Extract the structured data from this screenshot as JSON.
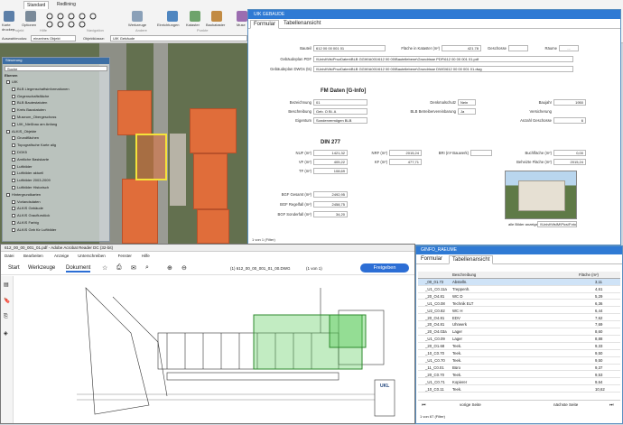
{
  "ribbon": {
    "tabs": [
      "Standard",
      "Redlining"
    ],
    "buttons": [
      "Karte drucken",
      "Optionen",
      "Werkzeuge",
      "Einrichtungen",
      "Kataster",
      "Baukataster",
      "Muse"
    ],
    "groups": [
      "Projekt",
      "Hilfe",
      "Navigation",
      "Andere",
      "Punkte"
    ],
    "fields": {
      "mode_label": "Auswahlmodus:",
      "mode_value": "einzelnes Objekt",
      "layer_label": "Objektklasse:",
      "layer_value": "UIK Gebäude"
    }
  },
  "layers": {
    "title": "Steuerung",
    "search": "Suche",
    "group_label": "Ebenen",
    "items": [
      "UIK",
      "BLB Liegenschaftsinformationen",
      "Gegenschaftsfläche",
      "BLB Bautestatuten",
      "Kreis Baustatuten",
      "Museum_Obergeschoss",
      "UIK_Nießbau am Anfang",
      "ALKIS_Objekte",
      "Grundflächen",
      "Topografische Karte alig",
      "DGK5",
      "Amtliche Basiskarte",
      "Luftbilder",
      "Luftbilder aktuell",
      "Luftbilder 2003-2009",
      "Luftbilder Historisch",
      "Hintergrundkarten",
      "Vorlandsdaten",
      "ALKIS Gebäude",
      "ALKIS Grauflurstück",
      "ALKIS Farbig",
      "ALKIS Geb für Luftbilder"
    ]
  },
  "form": {
    "window_title": "UIK GEBAUDE",
    "tabs": [
      "Formular",
      "Tabellenansicht"
    ],
    "fields": [
      {
        "label": "Bauteil",
        "value": "612 00 00 001 01"
      },
      {
        "label": "Fläche in Kataster (m²)",
        "value": "421.78"
      },
      {
        "label": "Geschosse",
        "value": ""
      },
      {
        "label": "Räume",
        "value": "..."
      },
      {
        "label": "Gebäudeplan PDF",
        "value": "\\\\UnivIt\\Ifs\\ProzDaten\\BLB GGW\\A001\\612 00 00\\Bautellebene\\Grundrisse PDF\\612 00 00 001 01.pdf"
      },
      {
        "label": "Gebäudeplan DWGs (ts)",
        "value": "\\\\UnivIt\\Ifs\\ProzDaten\\BLB GGW\\A001\\612 00 00\\Bautellebene\\Grundrisse DWG\\612 00 00 001 01.dwg"
      }
    ],
    "section_fm": "FM Daten [G-Info]",
    "fm": [
      {
        "label": "Bezeichnung",
        "value": "01"
      },
      {
        "label": "Beschreibung",
        "value": "Geb. O Bl. A"
      },
      {
        "label": "Eigentum",
        "value": "Sondervermögen BLB"
      },
      {
        "label": "Denkmalschutz",
        "value": "Nein"
      },
      {
        "label": "BLB Betreibervereinbarung",
        "value": "Ja"
      },
      {
        "label": "Versicherung",
        "value": ""
      },
      {
        "label": "Baujahr",
        "value": "1950"
      },
      {
        "label": "Anzahl Geschosse",
        "value": "6"
      }
    ],
    "section_din": "DIN 277",
    "din": [
      {
        "label": "NUF (m²)",
        "value": "1421,32"
      },
      {
        "label": "VF (m²)",
        "value": "405,22"
      },
      {
        "label": "TF (m²)",
        "value": "108,69"
      },
      {
        "label": "NRF (m²)",
        "value": "2015,24"
      },
      {
        "label": "KF (m²)",
        "value": "477,71"
      },
      {
        "label": "BRI (m³ Bauwerk)",
        "value": ""
      },
      {
        "label": "Buchfläche (m²)",
        "value": "0,00"
      },
      {
        "label": "Beheizte Fläche (m²)",
        "value": "2015,24"
      },
      {
        "label": "BGF Gesamt (m²)",
        "value": "2492,95"
      },
      {
        "label": "BGF Regelfall (m²)",
        "value": "2458,75"
      },
      {
        "label": "BGF Sonderfall (m²)",
        "value": "34,20"
      }
    ],
    "photo_caption": "alle Bilder anzeigen",
    "photo_file": "\\\\UnivIt\\IfsIM\\Pics\\Fotos",
    "status": "1 von 1 (Filter)"
  },
  "acrobat": {
    "window_title": "612_00_00_001_01.pdf - Adobe Acrobat Reader DC (32-bit)",
    "menu": [
      "Datei",
      "Bearbeiten",
      "Anzeige",
      "Unterschreiben",
      "Fenster",
      "Hilfe"
    ],
    "nav_tabs": [
      "Start",
      "Werkzeuge",
      "Dokument"
    ],
    "page_info": "(1) 612_00_00_001_01_00.DWG",
    "page_count": "(1 von 1)",
    "zoom": "12,3%",
    "share_button": "Freigeben",
    "logo_text": "UKL"
  },
  "ginfo": {
    "window_title": "GINFO_RAEUME",
    "tabs": [
      "Formular",
      "Tabellenansicht"
    ],
    "columns": [
      "Beschreibung",
      "Fläche (m²)"
    ],
    "rows": [
      {
        "id": "_00_01.72",
        "desc": "Abstelln.",
        "area": "3,11"
      },
      {
        "id": "_U1_C0.11a",
        "desc": "Treppenh.",
        "area": "4,61"
      },
      {
        "id": "_20_O4.81",
        "desc": "WC D",
        "area": "5,29"
      },
      {
        "id": "_U1_C0.08",
        "desc": "Technik ELT",
        "area": "6,36"
      },
      {
        "id": "_U2_C0.82",
        "desc": "WC H",
        "area": "6,44"
      },
      {
        "id": "_20_O4.81",
        "desc": "EDV",
        "area": "7,62"
      },
      {
        "id": "_20_O4.81",
        "desc": "Uhrwerk",
        "area": "7,69"
      },
      {
        "id": "_20_O4.03a",
        "desc": "Lager",
        "area": "8,60"
      },
      {
        "id": "_U1_C0.09",
        "desc": "Lager",
        "area": "8,88"
      },
      {
        "id": "_20_O1.68",
        "desc": "Teek.",
        "area": "9,33"
      },
      {
        "id": "_10_C0.70",
        "desc": "Teek.",
        "area": "9,50"
      },
      {
        "id": "_U1_C0.70",
        "desc": "Teek.",
        "area": "9,50"
      },
      {
        "id": "_11_C0.01",
        "desc": "Büro",
        "area": "9,37"
      },
      {
        "id": "_20_C0.70",
        "desc": "Teek.",
        "area": "9,53"
      },
      {
        "id": "_U1_C0.71",
        "desc": "Kopierer",
        "area": "9,64"
      },
      {
        "id": "_10_C0.11",
        "desc": "Teek.",
        "area": "10,62"
      }
    ],
    "footer_prev": "vorige Seite",
    "footer_next": "nächste Seite",
    "status": "1 von 67 (Filter)"
  }
}
